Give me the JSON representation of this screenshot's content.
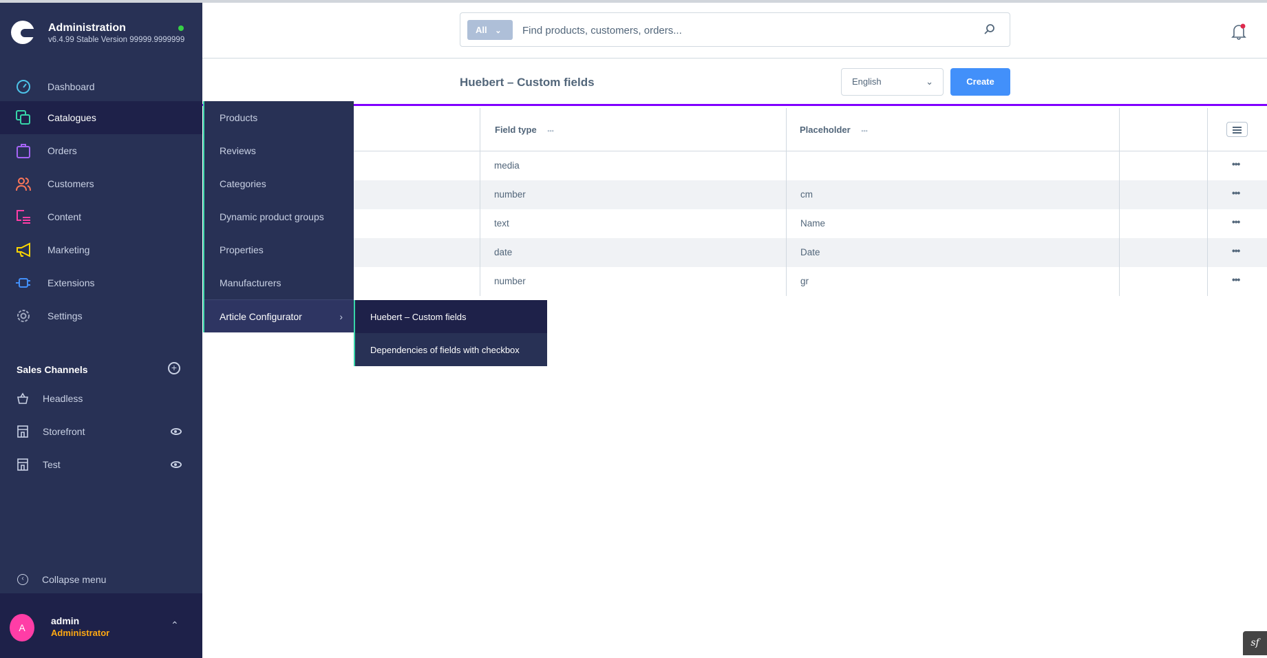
{
  "app": {
    "title": "Administration",
    "version": "v6.4.99 Stable Version 99999.9999999",
    "status_color": "#37d046"
  },
  "sidebar": {
    "items": [
      {
        "label": "Dashboard",
        "icon": "dashboard-gauge-icon",
        "color": "#4dc3e8"
      },
      {
        "label": "Catalogues",
        "icon": "catalogues-icon",
        "color": "#37d5a8"
      },
      {
        "label": "Orders",
        "icon": "shopping-bag-icon",
        "color": "#a564f5"
      },
      {
        "label": "Customers",
        "icon": "users-icon",
        "color": "#ff7759"
      },
      {
        "label": "Content",
        "icon": "content-icon",
        "color": "#ff3da6"
      },
      {
        "label": "Marketing",
        "icon": "megaphone-icon",
        "color": "#ffd700"
      },
      {
        "label": "Extensions",
        "icon": "plug-icon",
        "color": "#4290fa"
      },
      {
        "label": "Settings",
        "icon": "gear-icon",
        "color": "#a0a8bf"
      }
    ],
    "sales_channels": {
      "heading": "Sales Channels",
      "items": [
        {
          "label": "Headless"
        },
        {
          "label": "Storefront"
        },
        {
          "label": "Test"
        }
      ]
    },
    "collapse_label": "Collapse menu",
    "user": {
      "initial": "A",
      "name": "admin",
      "role": "Administrator"
    }
  },
  "flyout": {
    "items": [
      "Products",
      "Reviews",
      "Categories",
      "Dynamic product groups",
      "Properties",
      "Manufacturers",
      "Article Configurator"
    ]
  },
  "submenu": {
    "items": [
      "Huebert – Custom fields",
      "Dependencies of fields with checkbox"
    ]
  },
  "search": {
    "type": "All",
    "placeholder": "Find products, customers, orders..."
  },
  "page": {
    "title": "Huebert – Custom fields",
    "language": "English",
    "create_label": "Create"
  },
  "table": {
    "columns": [
      "Field type",
      "Placeholder"
    ],
    "rows": [
      {
        "field_type": "media",
        "placeholder": ""
      },
      {
        "field_type": "number",
        "placeholder": "cm"
      },
      {
        "field_type": "text",
        "placeholder": "Name"
      },
      {
        "field_type": "date",
        "placeholder": "Date"
      },
      {
        "field_type": "number",
        "placeholder": "gr"
      }
    ],
    "row_action": "•••",
    "col_menu": "•••"
  },
  "toolbar": {
    "symfony": "sf"
  }
}
